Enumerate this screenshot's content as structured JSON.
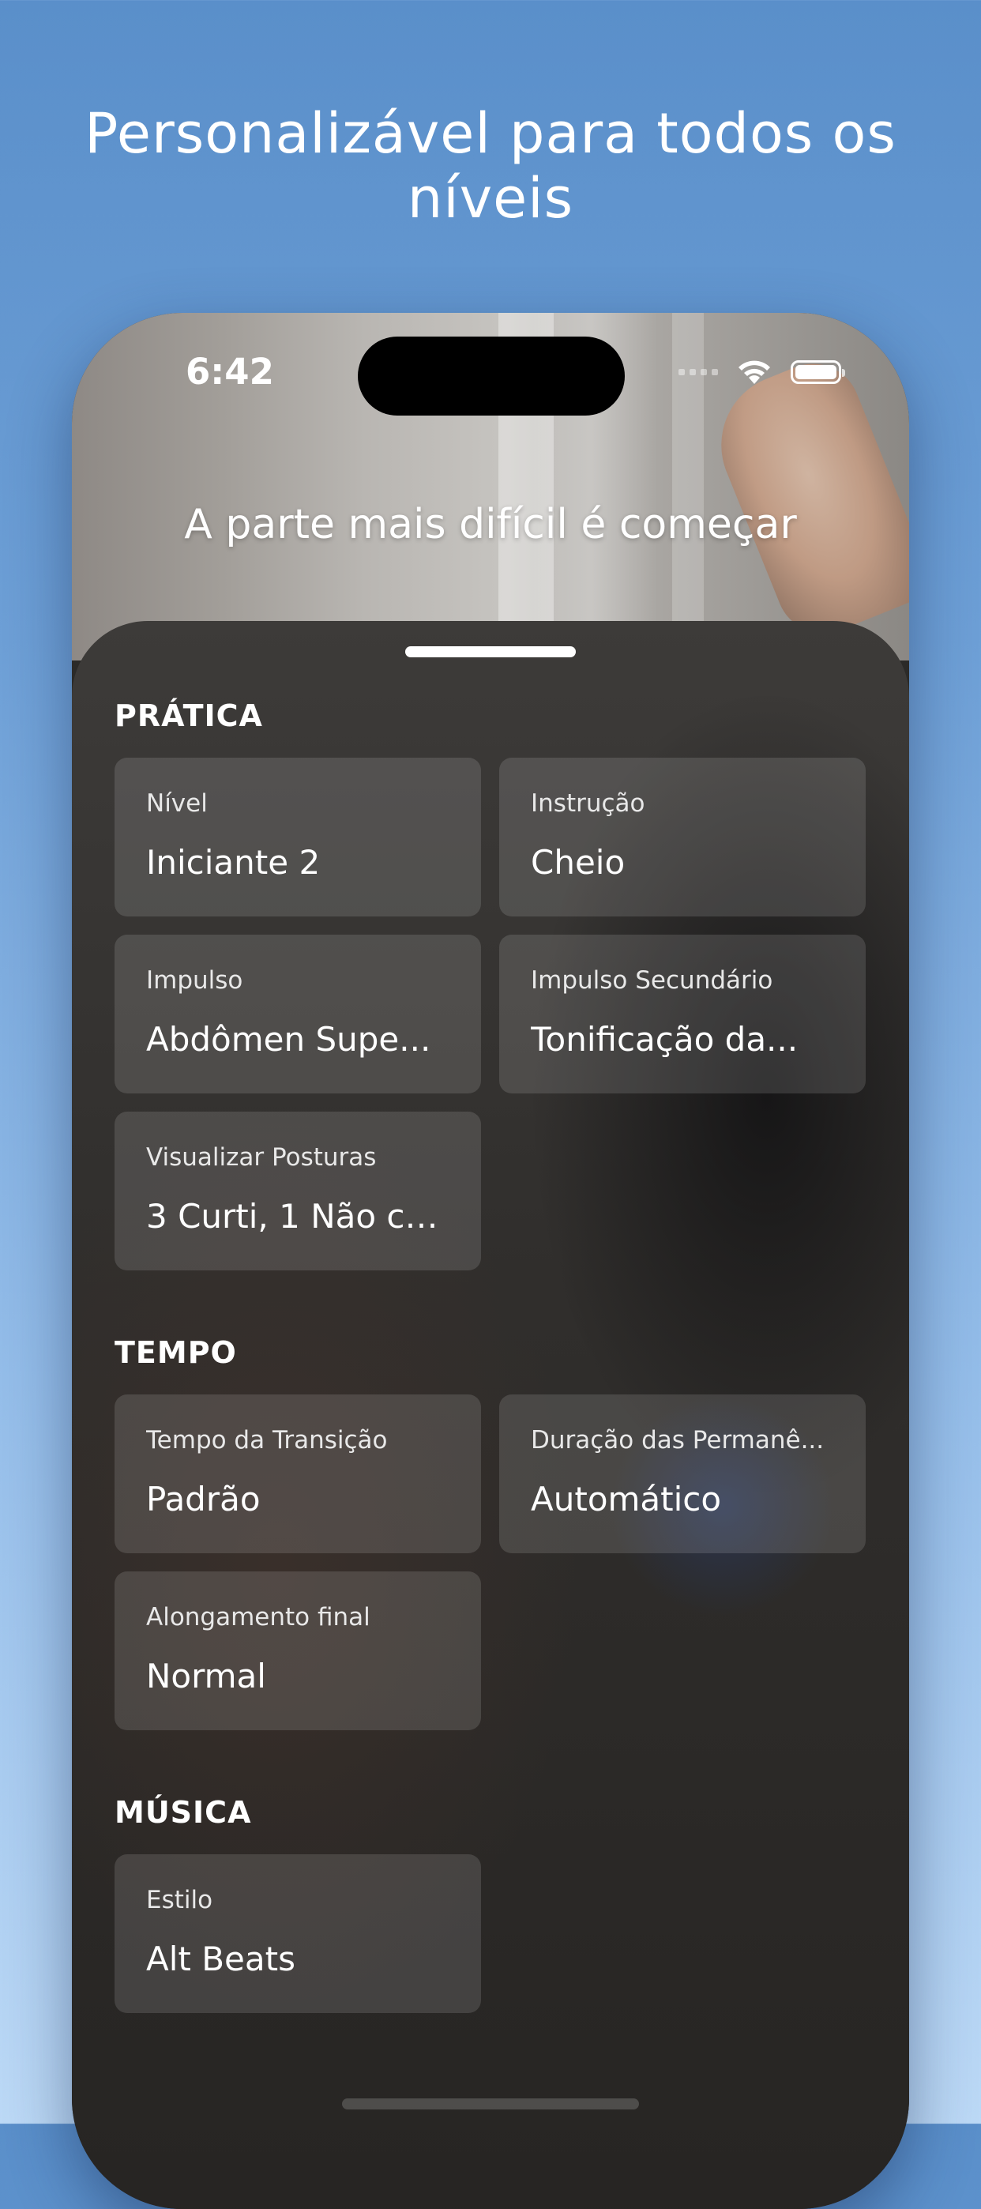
{
  "headline": "Personalizável para todos os níveis",
  "status_bar": {
    "time": "6:42",
    "icons": [
      "cellular-signal-icon",
      "wifi-icon",
      "battery-icon"
    ]
  },
  "tagline": "A parte mais difícil é começar",
  "sections": [
    {
      "title": "PRÁTICA",
      "cards": [
        {
          "label": "Nível",
          "value": "Iniciante 2"
        },
        {
          "label": "Instrução",
          "value": "Cheio"
        },
        {
          "label": "Impulso",
          "value": "Abdômen Supe..."
        },
        {
          "label": "Impulso Secundário",
          "value": "Tonificação da..."
        },
        {
          "label": "Visualizar Posturas",
          "value": "3 Curti, 1 Não cu..."
        }
      ]
    },
    {
      "title": "TEMPO",
      "cards": [
        {
          "label": "Tempo da Transição",
          "value": "Padrão"
        },
        {
          "label": "Duração das Permanê...",
          "value": "Automático"
        },
        {
          "label": "Alongamento final",
          "value": "Normal"
        }
      ]
    },
    {
      "title": "MÚSICA",
      "cards": [
        {
          "label": "Estilo",
          "value": "Alt Beats"
        }
      ]
    }
  ]
}
